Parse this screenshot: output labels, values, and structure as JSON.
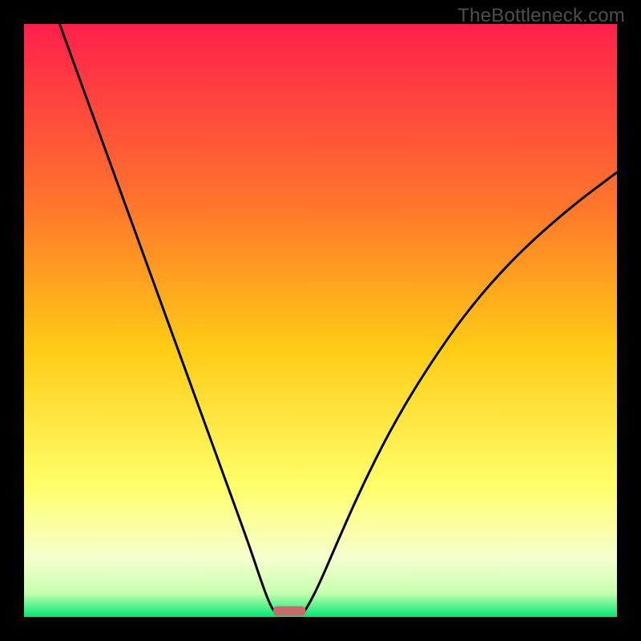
{
  "watermark": "TheBottleneck.com",
  "colors": {
    "top": "#ff1f4b",
    "mid_upper": "#ff6a2a",
    "mid": "#ffcc16",
    "mid_lower": "#ffff6a",
    "lower": "#f6ffce",
    "bottom": "#00e874",
    "bg": "#000000",
    "curve": "#000000",
    "marker": "#c96a6a"
  },
  "chart_data": {
    "type": "line",
    "title": "",
    "xlabel": "",
    "ylabel": "",
    "xlim": [
      0,
      100
    ],
    "ylim": [
      0,
      100
    ],
    "series": [
      {
        "name": "left-arc",
        "x": [
          6,
          10,
          14,
          18,
          22,
          26,
          30,
          34,
          38,
          40,
          41.5,
          42.5
        ],
        "y": [
          100,
          89,
          78,
          67,
          56,
          45,
          34,
          23,
          12,
          6,
          2,
          0.5
        ]
      },
      {
        "name": "right-arc",
        "x": [
          47,
          48,
          50,
          53,
          57,
          62,
          68,
          75,
          83,
          92,
          100
        ],
        "y": [
          0.5,
          2,
          6,
          13,
          22,
          32,
          42,
          52,
          61,
          69,
          75
        ]
      }
    ],
    "marker": {
      "x_start": 42,
      "x_end": 47.5,
      "y": 0.2,
      "height": 1.6
    },
    "gradient_stops": [
      {
        "offset": 0,
        "color": "#ff1f4b"
      },
      {
        "offset": 32,
        "color": "#ff7a2a"
      },
      {
        "offset": 55,
        "color": "#ffcc16"
      },
      {
        "offset": 78,
        "color": "#ffff6a"
      },
      {
        "offset": 90,
        "color": "#f6ffce"
      },
      {
        "offset": 96,
        "color": "#c6ffb0"
      },
      {
        "offset": 100,
        "color": "#00e874"
      }
    ]
  }
}
